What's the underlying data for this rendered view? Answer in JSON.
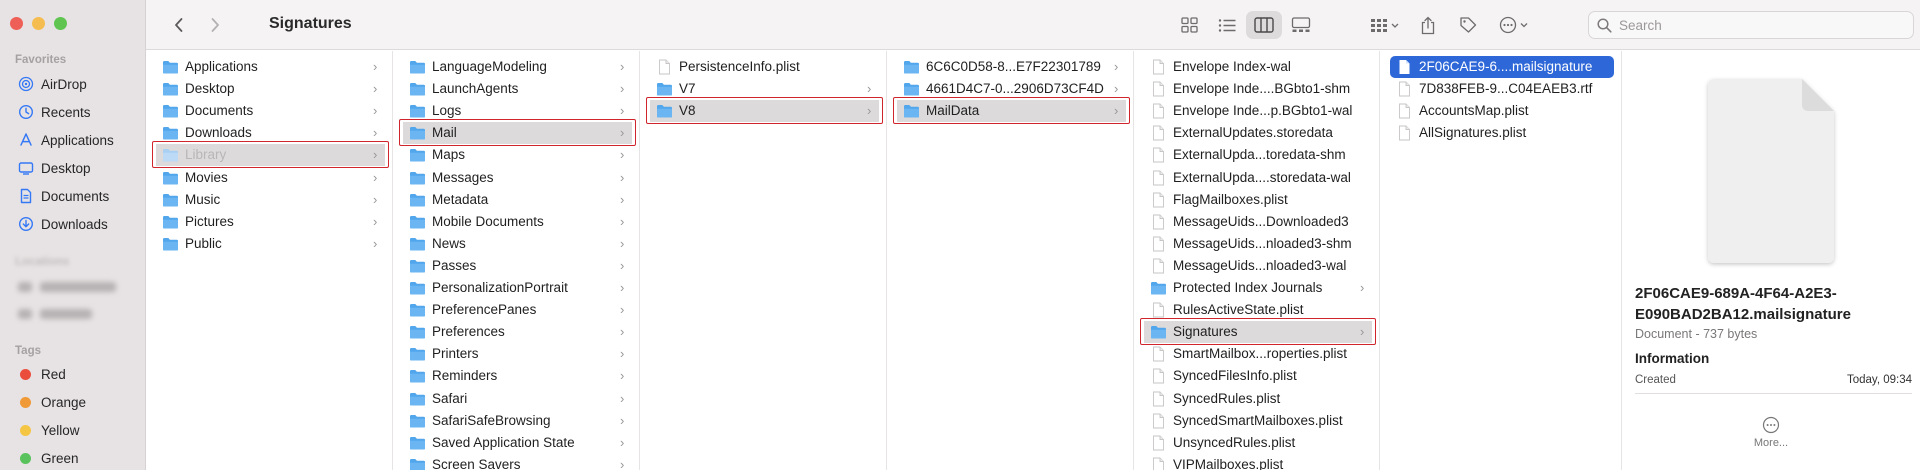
{
  "toolbar": {
    "title": "Signatures",
    "search_placeholder": "Search"
  },
  "sidebar": {
    "favorites_heading": "Favorites",
    "favorites": [
      {
        "label": "AirDrop",
        "icon": "airdrop-icon"
      },
      {
        "label": "Recents",
        "icon": "clock-icon"
      },
      {
        "label": "Applications",
        "icon": "applications-icon"
      },
      {
        "label": "Desktop",
        "icon": "desktop-icon"
      },
      {
        "label": "Documents",
        "icon": "document-icon"
      },
      {
        "label": "Downloads",
        "icon": "download-icon"
      }
    ],
    "locations_heading": "Locations",
    "tags_heading": "Tags",
    "tags": [
      {
        "label": "Red",
        "color": "#eb4d3d"
      },
      {
        "label": "Orange",
        "color": "#f09a37"
      },
      {
        "label": "Yellow",
        "color": "#f5c643"
      },
      {
        "label": "Green",
        "color": "#5ac25c"
      }
    ],
    "accent": "#3478f6"
  },
  "columns": [
    {
      "items": [
        {
          "label": "Applications",
          "type": "folder",
          "chevron": true
        },
        {
          "label": "Desktop",
          "type": "folder",
          "chevron": true
        },
        {
          "label": "Documents",
          "type": "folder",
          "chevron": true
        },
        {
          "label": "Downloads",
          "type": "folder",
          "chevron": true
        },
        {
          "label": "Library",
          "type": "folder",
          "chevron": true,
          "selected": true,
          "dimmed": true,
          "boxed": true
        },
        {
          "label": "Movies",
          "type": "folder",
          "chevron": true
        },
        {
          "label": "Music",
          "type": "folder",
          "chevron": true
        },
        {
          "label": "Pictures",
          "type": "folder",
          "chevron": true
        },
        {
          "label": "Public",
          "type": "folder",
          "chevron": true
        }
      ]
    },
    {
      "items": [
        {
          "label": "LanguageModeling",
          "type": "folder",
          "chevron": true
        },
        {
          "label": "LaunchAgents",
          "type": "folder",
          "chevron": true
        },
        {
          "label": "Logs",
          "type": "folder",
          "chevron": true
        },
        {
          "label": "Mail",
          "type": "folder",
          "chevron": true,
          "selected": true,
          "boxed": true
        },
        {
          "label": "Maps",
          "type": "folder",
          "chevron": true
        },
        {
          "label": "Messages",
          "type": "folder",
          "chevron": true
        },
        {
          "label": "Metadata",
          "type": "folder",
          "chevron": true
        },
        {
          "label": "Mobile Documents",
          "type": "folder",
          "chevron": true
        },
        {
          "label": "News",
          "type": "folder",
          "chevron": true
        },
        {
          "label": "Passes",
          "type": "folder",
          "chevron": true
        },
        {
          "label": "PersonalizationPortrait",
          "type": "folder",
          "chevron": true
        },
        {
          "label": "PreferencePanes",
          "type": "folder",
          "chevron": true
        },
        {
          "label": "Preferences",
          "type": "folder",
          "chevron": true
        },
        {
          "label": "Printers",
          "type": "folder",
          "chevron": true
        },
        {
          "label": "Reminders",
          "type": "folder",
          "chevron": true
        },
        {
          "label": "Safari",
          "type": "folder",
          "chevron": true
        },
        {
          "label": "SafariSafeBrowsing",
          "type": "folder",
          "chevron": true
        },
        {
          "label": "Saved Application State",
          "type": "folder",
          "chevron": true
        },
        {
          "label": "Screen Savers",
          "type": "folder",
          "chevron": true
        }
      ]
    },
    {
      "items": [
        {
          "label": "PersistenceInfo.plist",
          "type": "file",
          "chevron": false
        },
        {
          "label": "V7",
          "type": "folder",
          "chevron": true
        },
        {
          "label": "V8",
          "type": "folder",
          "chevron": true,
          "selected": true,
          "boxed": true
        }
      ]
    },
    {
      "items": [
        {
          "label": "6C6C0D58-8...E7F22301789",
          "type": "folder",
          "chevron": true
        },
        {
          "label": "4661D4C7-0...2906D73CF4D",
          "type": "folder",
          "chevron": true
        },
        {
          "label": "MailData",
          "type": "folder",
          "chevron": true,
          "selected": true,
          "boxed": true
        }
      ]
    },
    {
      "items": [
        {
          "label": "Envelope Index-wal",
          "type": "file",
          "chevron": false
        },
        {
          "label": "Envelope Inde....BGbto1-shm",
          "type": "file",
          "chevron": false
        },
        {
          "label": "Envelope Inde...p.BGbto1-wal",
          "type": "file",
          "chevron": false
        },
        {
          "label": "ExternalUpdates.storedata",
          "type": "file",
          "chevron": false
        },
        {
          "label": "ExternalUpda...toredata-shm",
          "type": "file",
          "chevron": false
        },
        {
          "label": "ExternalUpda....storedata-wal",
          "type": "file",
          "chevron": false
        },
        {
          "label": "FlagMailboxes.plist",
          "type": "file",
          "chevron": false
        },
        {
          "label": "MessageUids...Downloaded3",
          "type": "file",
          "chevron": false
        },
        {
          "label": "MessageUids...nloaded3-shm",
          "type": "file",
          "chevron": false
        },
        {
          "label": "MessageUids...nloaded3-wal",
          "type": "file",
          "chevron": false
        },
        {
          "label": "Protected Index Journals",
          "type": "folder",
          "chevron": true
        },
        {
          "label": "RulesActiveState.plist",
          "type": "file",
          "chevron": false
        },
        {
          "label": "Signatures",
          "type": "folder",
          "chevron": true,
          "selected": true,
          "boxed": true
        },
        {
          "label": "SmartMailbox...roperties.plist",
          "type": "file",
          "chevron": false
        },
        {
          "label": "SyncedFilesInfo.plist",
          "type": "file",
          "chevron": false
        },
        {
          "label": "SyncedRules.plist",
          "type": "file",
          "chevron": false
        },
        {
          "label": "SyncedSmartMailboxes.plist",
          "type": "file",
          "chevron": false
        },
        {
          "label": "UnsyncedRules.plist",
          "type": "file",
          "chevron": false
        },
        {
          "label": "VIPMailboxes.plist",
          "type": "file",
          "chevron": false
        }
      ]
    },
    {
      "items": [
        {
          "label": "2F06CAE9-6....mailsignature",
          "type": "file-blue",
          "chevron": false,
          "highlighted": true
        },
        {
          "label": "7D838FEB-9...C04EAEB3.rtf",
          "type": "file",
          "chevron": false
        },
        {
          "label": "AccountsMap.plist",
          "type": "file",
          "chevron": false
        },
        {
          "label": "AllSignatures.plist",
          "type": "file",
          "chevron": false
        }
      ]
    }
  ],
  "preview": {
    "file_name": "2F06CAE9-689A-4F64-A2E3-E090BAD2BA12.mailsignature",
    "kind": "Document - 737 bytes",
    "info_heading": "Information",
    "created_label": "Created",
    "created_value": "Today, 09:34",
    "more_label": "More..."
  }
}
